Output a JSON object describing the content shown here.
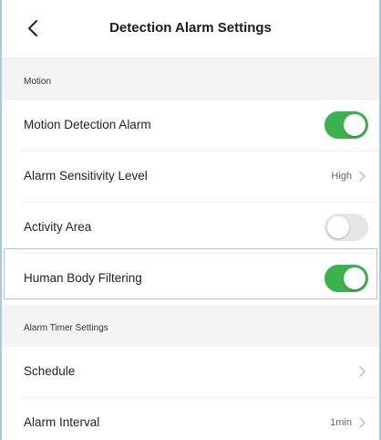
{
  "header": {
    "title": "Detection Alarm Settings",
    "back_icon": "chevron-left-icon"
  },
  "sections": [
    {
      "title": "Motion",
      "rows": [
        {
          "label": "Motion Detection Alarm",
          "control": "toggle",
          "state": "on"
        },
        {
          "label": "Alarm Sensitivity Level",
          "control": "value",
          "value": "High"
        },
        {
          "label": "Activity Area",
          "control": "toggle",
          "state": "off"
        },
        {
          "label": "Human Body Filtering",
          "control": "toggle",
          "state": "on",
          "highlighted": true
        }
      ]
    },
    {
      "title": "Alarm Timer Settings",
      "rows": [
        {
          "label": "Schedule",
          "control": "chevron"
        },
        {
          "label": "Alarm Interval",
          "control": "value",
          "value": "1min"
        }
      ]
    }
  ],
  "colors": {
    "toggle_on": "#3db14e",
    "toggle_off": "#e6e6e6",
    "section_bg": "#f4f4f5",
    "highlight_border": "#a9c9dd"
  }
}
